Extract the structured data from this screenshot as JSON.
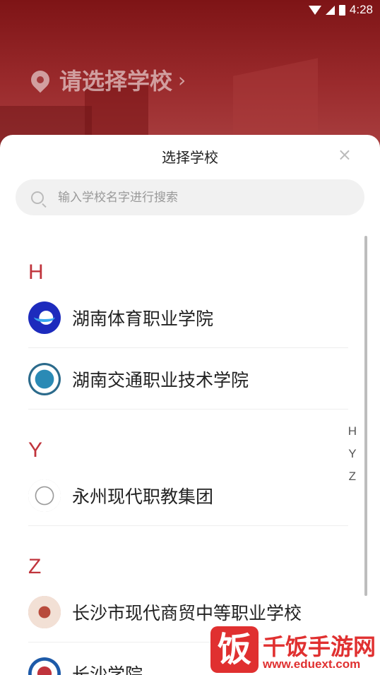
{
  "status_bar": {
    "time": "4:28"
  },
  "header": {
    "location_label": "请选择学校",
    "arrow": "›"
  },
  "sheet": {
    "title": "选择学校",
    "close_glyph": "×",
    "search": {
      "placeholder": "输入学校名字进行搜索",
      "value": ""
    }
  },
  "groups": [
    {
      "letter": "H",
      "schools": [
        {
          "name": "湖南体育职业学院"
        },
        {
          "name": "湖南交通职业技术学院"
        }
      ]
    },
    {
      "letter": "Y",
      "schools": [
        {
          "name": "永州现代职教集团"
        }
      ]
    },
    {
      "letter": "Z",
      "schools": [
        {
          "name": "长沙市现代商贸中等职业学校"
        },
        {
          "name": "长沙学院"
        }
      ]
    }
  ],
  "index_letters": [
    "H",
    "Y",
    "Z"
  ],
  "watermark": {
    "glyph": "饭",
    "brand": "千饭手游网",
    "url": "www.eduext.com"
  },
  "colors": {
    "accent": "#c0343c",
    "header_bg": "#8a1a1c"
  }
}
